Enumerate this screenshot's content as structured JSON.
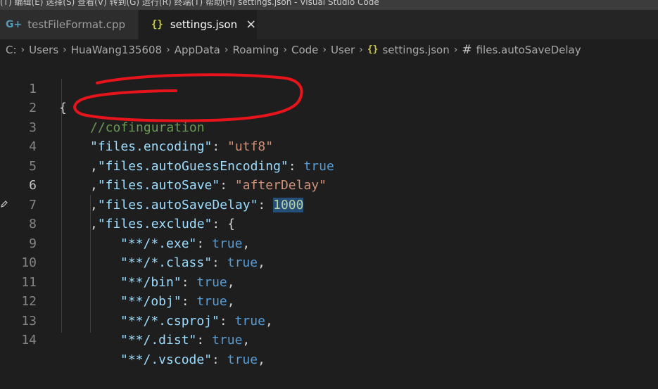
{
  "window": {
    "title_fragment": "(T)   编辑(E)   选择(S)   查看(V)   转到(G)   运行(R)   终端(T)   帮助(H)        settings.json - Visual Studio Code"
  },
  "tabs": [
    {
      "label": "testFileFormat.cpp",
      "icon": "cpp-icon",
      "active": false
    },
    {
      "label": "settings.json",
      "icon": "json-icon",
      "active": true,
      "close_glyph": "×"
    }
  ],
  "breadcrumb": {
    "items": [
      "C:",
      "Users",
      "HuaWang135608",
      "AppData",
      "Roaming",
      "Code",
      "User",
      "settings.json",
      "files.autoSaveDelay"
    ]
  },
  "editor": {
    "current_line": 6,
    "lines": [
      {
        "num": "1"
      },
      {
        "num": "2"
      },
      {
        "num": "3"
      },
      {
        "num": "4"
      },
      {
        "num": "5"
      },
      {
        "num": "6"
      },
      {
        "num": "7"
      },
      {
        "num": "8"
      },
      {
        "num": "9"
      },
      {
        "num": "10"
      },
      {
        "num": "11"
      },
      {
        "num": "12"
      },
      {
        "num": "13"
      },
      {
        "num": "14"
      }
    ],
    "code": {
      "brace_open": "{",
      "comment": "//cofinguration",
      "k3": "\"files.encoding\"",
      "v3": "\"utf8\"",
      "k4": "\"files.autoGuessEncoding\"",
      "v4": "true",
      "k5": "\"files.autoSave\"",
      "v5": "\"afterDelay\"",
      "k6": "\"files.autoSaveDelay\"",
      "v6": "1000",
      "k7": "\"files.exclude\"",
      "k8": "\"**/*.exe\"",
      "v8": "true",
      "k9": "\"**/*.class\"",
      "v9": "true",
      "k10": "\"**/bin\"",
      "v10": "true",
      "k11": "\"**/obj\"",
      "v11": "true",
      "k12": "\"**/*.csproj\"",
      "v12": "true",
      "k13": "\"**/.dist\"",
      "v13": "true",
      "k14": "\"**/.vscode\"",
      "v14": "true"
    }
  },
  "colors": {
    "background": "#1e1e1e",
    "key": "#9cdcfe",
    "string": "#ce9178",
    "boolean": "#569cd6",
    "number": "#b5cea8",
    "comment": "#6a9955",
    "annotation": "#e8141b"
  }
}
